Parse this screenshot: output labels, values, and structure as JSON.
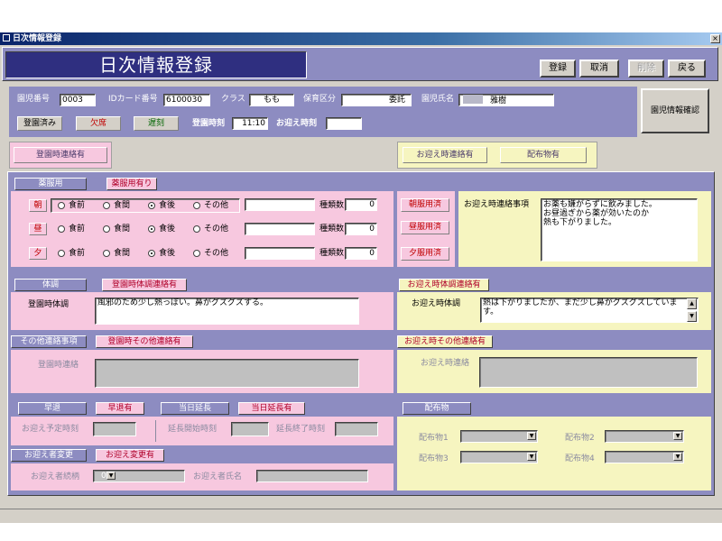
{
  "window": {
    "title": "日次情報登録",
    "close_glyph": "×"
  },
  "header": {
    "title": "日次情報登録"
  },
  "toolbar": {
    "register": "登録",
    "cancel": "取消",
    "delete": "削除",
    "back": "戻る",
    "child_info": "園児情報確認"
  },
  "info": {
    "child_no_label": "園児番号",
    "child_no": "0003",
    "id_card_label": "IDカード番号",
    "id_card": "6100030",
    "class_label": "クラス",
    "class": "もも",
    "care_label": "保育区分",
    "care": "委託",
    "name_label": "園児氏名",
    "name": "雅樹",
    "attended": "登園済み",
    "absent": "欠席",
    "late": "遅刻",
    "arrival_time_label": "登園時刻",
    "arrival_time": "11:10",
    "pickup_time_label": "お迎え時刻",
    "pickup_time": ""
  },
  "contact": {
    "arrival_contact": "登園時連絡有",
    "pickup_contact": "お迎え時連絡有",
    "distribution_item": "配布物有"
  },
  "medication": {
    "title": "薬服用",
    "has": "薬服用有り",
    "opt_before": "食前",
    "opt_between": "食間",
    "opt_after": "食後",
    "opt_other": "その他",
    "count_label": "種類数",
    "rows": [
      {
        "label": "朝",
        "done": "朝服用済",
        "count": "0"
      },
      {
        "label": "昼",
        "done": "昼服用済",
        "count": "0"
      },
      {
        "label": "夕",
        "done": "夕服用済",
        "count": "0"
      }
    ],
    "pickup_note_label": "お迎え時連絡事項",
    "pickup_note": [
      "お薬も嫌がらずに飲みました。",
      "お昼過ぎから薬が効いたのか",
      "熱も下がりました。"
    ]
  },
  "condition": {
    "title": "体調",
    "arrival_contact": "登園時体調連絡有",
    "pickup_contact": "お迎え時体調連絡有",
    "arrival_label": "登園時体調",
    "arrival_value": "風邪のため少し熱っぽい。鼻がグズグズする。",
    "pickup_label": "お迎え時体調",
    "pickup_value": "熱は下がりましたが、まだ少し鼻がグズグズしていま",
    "pickup_value2": "す。"
  },
  "other": {
    "title": "その他連絡事項",
    "arrival_contact": "登園時その他連絡有",
    "pickup_contact": "お迎え時その他連絡有",
    "arrival_label": "登園時連絡",
    "pickup_label": "お迎え時連絡"
  },
  "early_leave": {
    "title": "早退",
    "has": "早退有",
    "pickup_scheduled_label": "お迎え予定時刻"
  },
  "extension": {
    "title": "当日延長",
    "has": "当日延長有",
    "start_label": "延長開始時刻",
    "end_label": "延長終了時刻"
  },
  "guardian": {
    "title": "お迎え者変更",
    "has": "お迎え変更有",
    "relation_label": "お迎え者続柄",
    "relation_value": "0",
    "name_label": "お迎え者氏名"
  },
  "distribution": {
    "title": "配布物",
    "item1": "配布物1",
    "item2": "配布物2",
    "item3": "配布物3",
    "item4": "配布物4"
  },
  "colors": {
    "purple": "#8d8cc1",
    "navy": "#2f2f7f",
    "pink": "#f7c8df",
    "yellow": "#f6f5c0",
    "red_text": "#c00000",
    "green_text": "#006400"
  }
}
